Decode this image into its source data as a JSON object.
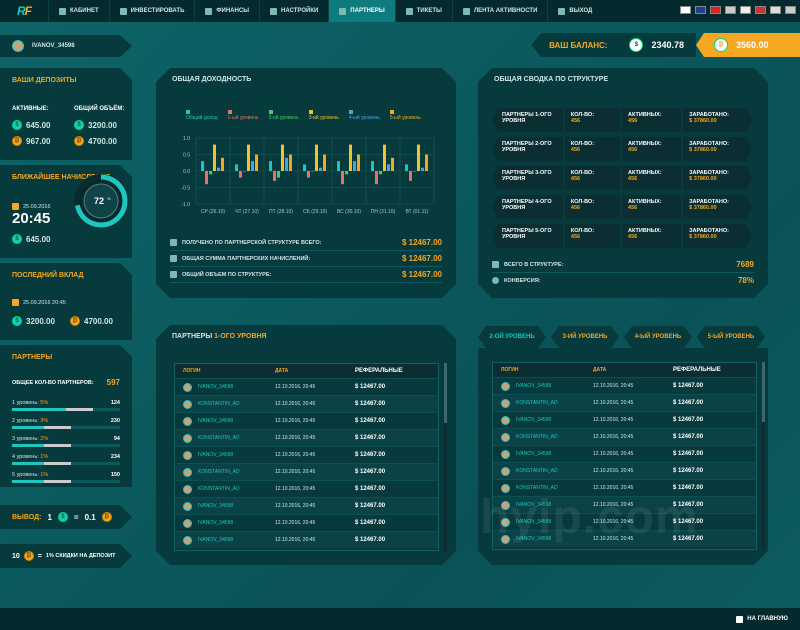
{
  "nav": {
    "logo": "RF",
    "items": [
      {
        "label": "КАБИНЕТ",
        "icon": "home-icon"
      },
      {
        "label": "ИНВЕСТИРОВАТЬ",
        "icon": "invest-icon"
      },
      {
        "label": "ФИНАНСЫ",
        "icon": "wallet-icon"
      },
      {
        "label": "НАСТРОЙКИ",
        "icon": "gear-icon"
      },
      {
        "label": "ПАРТНЕРЫ",
        "icon": "users-icon",
        "active": true
      },
      {
        "label": "ТИКЕТЫ",
        "icon": "ticket-icon"
      },
      {
        "label": "ЛЕНТА АКТИВНОСТИ",
        "icon": "feed-icon"
      },
      {
        "label": "ВЫХОД",
        "icon": "exit-icon"
      }
    ],
    "flags": [
      "ru-flag",
      "gb-flag",
      "cn-flag",
      "flag-4",
      "flag-5",
      "flag-6",
      "flag-7",
      "flag-8"
    ]
  },
  "user": {
    "name": "IVANOV_34598"
  },
  "balance": {
    "label": "ВАШ БАЛАНС:",
    "value1": "2340.78",
    "value2": "3560.00"
  },
  "deposits": {
    "title": "ВАШИ ДЕПОЗИТЫ",
    "active_label": "АКТИВНЫЕ:",
    "total_label": "ОБЩИЙ ОБЪЁМ:",
    "a1": "645.00",
    "a2": "967.00",
    "t1": "3200.00",
    "t2": "4700.00"
  },
  "next_accrual": {
    "title": "БЛИЖАЙШЕЕ НАЧИСЛЕНИЕ",
    "date": "25.09.2016",
    "time": "20:45",
    "amount": "645.00",
    "percent": "72",
    "percent_sign": "%",
    "progress": 0.72
  },
  "last_deposit": {
    "title": "ПОСЛЕДНИЙ ВКЛАД",
    "datetime": "25.09.2016  20:45",
    "v1": "3200.00",
    "v2": "4700.00"
  },
  "partners": {
    "title": "ПАРТНЕРЫ",
    "total_label": "ОБЩЕЕ КОЛ-ВО ПАРТНЕРОВ:",
    "total": "597",
    "levels": [
      {
        "label": "1 уровень:",
        "pct": "5%",
        "count": "124",
        "fill": 0.05
      },
      {
        "label": "2 уровень:",
        "pct": "3%",
        "count": "230",
        "fill": 0.03
      },
      {
        "label": "3 уровень:",
        "pct": "2%",
        "count": "94",
        "fill": 0.02
      },
      {
        "label": "4 уровень:",
        "pct": "1%",
        "count": "234",
        "fill": 0.01
      },
      {
        "label": "5 уровень:",
        "pct": "1%",
        "count": "150",
        "fill": 0.01
      }
    ]
  },
  "withdraw": {
    "label": "ВЫВОД:",
    "a": "1",
    "eq": "=",
    "b": "0.1"
  },
  "discount": {
    "a": "10",
    "eq": "=",
    "text": "1% СКИДКИ НА ДЕПОЗИТ"
  },
  "income": {
    "title": "ОБЩАЯ ДОХОДНОСТЬ",
    "rows": [
      {
        "label": "ПОЛУЧЕНО ПО ПАРТНЕРСКОЙ СТРУКТУРЕ ВСЕГО:",
        "value": "$ 12467.00"
      },
      {
        "label": "ОБЩАЯ СУММА ПАРТНЕРСКИХ НАЧИСЛЕНИЙ:",
        "value": "$ 12467.00"
      },
      {
        "label": "ОБЩИЙ ОБЪЕМ ПО СТРУКТУРЕ:",
        "value": "$ 12467.00"
      }
    ]
  },
  "chart_data": {
    "type": "bar",
    "title": "",
    "categories": [
      "СР (26.10)",
      "ЧТ (27.10)",
      "ПТ (28.10)",
      "СБ (29.10)",
      "ВС (30.10)",
      "ПН (31.10)",
      "ВТ (01.11)"
    ],
    "ylim": [
      -1.0,
      1.0
    ],
    "yticks": [
      "1.0",
      "0.5",
      "0.0",
      "-0.5",
      "-1.0"
    ],
    "grid": true,
    "legend_position": "top",
    "series": [
      {
        "name": "Общий доход",
        "color": "#1fc6c0",
        "values": [
          0.3,
          0.2,
          0.3,
          0.2,
          0.3,
          0.3,
          0.2
        ]
      },
      {
        "name": "1-ый уровень",
        "color": "#e8706c",
        "values": [
          -0.4,
          -0.2,
          -0.3,
          -0.2,
          -0.4,
          -0.4,
          -0.3
        ]
      },
      {
        "name": "2-ой уровень",
        "color": "#3ecf5c",
        "values": [
          -0.1,
          0.0,
          -0.2,
          0.0,
          -0.1,
          -0.1,
          0.0
        ]
      },
      {
        "name": "3-ий уровень",
        "color": "#f2c12e",
        "values": [
          0.8,
          0.8,
          0.8,
          0.8,
          0.8,
          0.8,
          0.8
        ]
      },
      {
        "name": "4-ый уровень",
        "color": "#4aa3df",
        "values": [
          0.1,
          0.3,
          0.4,
          0.1,
          0.3,
          0.2,
          0.1
        ]
      },
      {
        "name": "5-ый уровень",
        "color": "#f5a623",
        "values": [
          0.4,
          0.5,
          0.5,
          0.5,
          0.5,
          0.4,
          0.5
        ]
      }
    ]
  },
  "structure": {
    "title": "ОБЩАЯ СВОДКА ПО СТРУКТУРЕ",
    "rows": [
      {
        "level": "ПАРТНЕРЫ 1-ОГО УРОВНЯ",
        "count_label": "КОЛ-ВО:",
        "count": "456",
        "active_label": "АКТИВНЫХ:",
        "active": "456",
        "earned_label": "ЗАРАБОТАНО:",
        "earned": "$ 37860.00"
      },
      {
        "level": "ПАРТНЕРЫ 2-ОГО УРОВНЯ",
        "count_label": "КОЛ-ВО:",
        "count": "456",
        "active_label": "АКТИВНЫХ:",
        "active": "456",
        "earned_label": "ЗАРАБОТАНО:",
        "earned": "$ 37860.00"
      },
      {
        "level": "ПАРТНЕРЫ 3-ОГО УРОВНЯ",
        "count_label": "КОЛ-ВО:",
        "count": "456",
        "active_label": "АКТИВНЫХ:",
        "active": "456",
        "earned_label": "ЗАРАБОТАНО:",
        "earned": "$ 37860.00"
      },
      {
        "level": "ПАРТНЕРЫ 4-ОГО УРОВНЯ",
        "count_label": "КОЛ-ВО:",
        "count": "456",
        "active_label": "АКТИВНЫХ:",
        "active": "456",
        "earned_label": "ЗАРАБОТАНО:",
        "earned": "$ 37860.00"
      },
      {
        "level": "ПАРТНЕРЫ 5-ОГО УРОВНЯ",
        "count_label": "КОЛ-ВО:",
        "count": "456",
        "active_label": "АКТИВНЫХ:",
        "active": "456",
        "earned_label": "ЗАРАБОТАНО:",
        "earned": "$ 37860.00"
      }
    ],
    "total_label": "ВСЕГО В СТРУКТУРЕ:",
    "total": "7689",
    "conv_label": "КОНВЕРСИЯ:",
    "conv": "78%"
  },
  "level1": {
    "title_a": "ПАРТНЕРЫ ",
    "title_b": "1-ОГО УРОВНЯ",
    "headers": [
      "ЛОГИН",
      "ДАТА",
      "РЕФЕРАЛЬНЫЕ"
    ],
    "rows": [
      [
        "IVANOV_34598",
        "12.10.2016, 20:45",
        "$ 12467.00"
      ],
      [
        "KONSTANTIN_AD",
        "12.10.2016, 20:45",
        "$ 12467.00"
      ],
      [
        "IVANOV_34598",
        "12.10.2016, 20:45",
        "$ 12467.00"
      ],
      [
        "KONSTANTIN_AD",
        "12.10.2016, 20:45",
        "$ 12467.00"
      ],
      [
        "IVANOV_34598",
        "12.10.2016, 20:45",
        "$ 12467.00"
      ],
      [
        "KONSTANTIN_AD",
        "12.10.2016, 20:45",
        "$ 12467.00"
      ],
      [
        "KONSTANTIN_AD",
        "12.10.2016, 20:45",
        "$ 12467.00"
      ],
      [
        "IVANOV_34598",
        "12.10.2016, 20:45",
        "$ 12467.00"
      ],
      [
        "IVANOV_34598",
        "12.10.2016, 20:45",
        "$ 12467.00"
      ],
      [
        "IVANOV_34598",
        "12.10.2016, 20:45",
        "$ 12467.00"
      ]
    ]
  },
  "levels_tabs": [
    "2-ОЙ УРОВЕНЬ",
    "3-ИЙ УРОВЕНЬ",
    "4-ЫЙ УРОВЕНЬ",
    "5-ЫЙ УРОВЕНЬ"
  ],
  "level2": {
    "headers": [
      "ЛОГИН",
      "ДАТА",
      "РЕФЕРАЛЬНЫЕ"
    ],
    "rows": [
      [
        "IVANOV_34598",
        "12.10.2016, 20:45",
        "$ 12467.00"
      ],
      [
        "KONSTANTIN_AD",
        "12.10.2016, 20:45",
        "$ 12467.00"
      ],
      [
        "IVANOV_34598",
        "12.10.2016, 20:45",
        "$ 12467.00"
      ],
      [
        "KONSTANTIN_AD",
        "12.10.2016, 20:45",
        "$ 12467.00"
      ],
      [
        "IVANOV_34598",
        "12.10.2016, 20:45",
        "$ 12467.00"
      ],
      [
        "KONSTANTIN_AD",
        "12.10.2016, 20:45",
        "$ 12467.00"
      ],
      [
        "KONSTANTIN_AD",
        "12.10.2016, 20:45",
        "$ 12467.00"
      ],
      [
        "IVANOV_34598",
        "12.10.2016, 20:45",
        "$ 12467.00"
      ],
      [
        "IVANOV_34598",
        "12.10.2016, 20:45",
        "$ 12467.00"
      ],
      [
        "IVANOV_34598",
        "12.10.2016, 20:45",
        "$ 12467.00"
      ]
    ]
  },
  "footer": {
    "home": "НА ГЛАВНУЮ"
  },
  "watermark": "hyip.com"
}
